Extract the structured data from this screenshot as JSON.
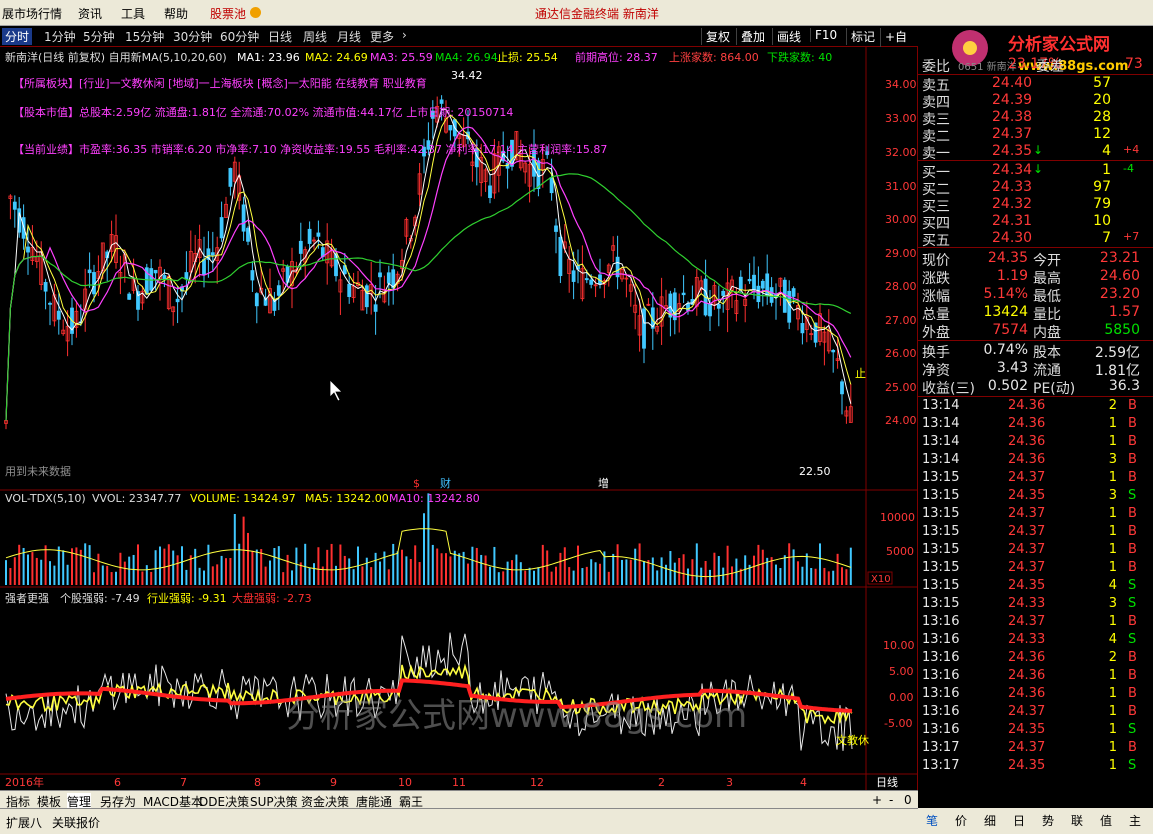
{
  "menubar": {
    "items": [
      "展市场行情",
      "资讯",
      "工具",
      "帮助",
      "股票池"
    ],
    "center": "通达信金融终端   新南洋",
    "logo_text": "分析家公式网",
    "logo_url": "www.88gs.com",
    "logo_sub": "0651 新南洋"
  },
  "timeframes": {
    "items": [
      "分时",
      "1分钟",
      "5分钟",
      "15分钟",
      "30分钟",
      "60分钟",
      "日线",
      "周线",
      "月线",
      "更多"
    ],
    "active": "分时",
    "right": [
      "复权",
      "叠加",
      "画线",
      "F10",
      "标记",
      "+自选"
    ]
  },
  "price_chart": {
    "title": "新南洋(日线 前复权) 自用新MA(5,10,20,60)",
    "ma_labels": [
      "MA1: 23.96",
      "MA2: 24.69",
      "MA3: 25.59",
      "MA4: 26.94",
      "止损: 25.54",
      "前期高位: 28.37",
      "上涨家数: 864.00",
      "下跌家数: 40"
    ],
    "info_lines": [
      "【所属板块】[行业]一文教休闲 [地域]一上海板块 [概念]一太阳能 在线教育 职业教育",
      "【股本市值】总股本:2.59亿 流通盘:1.81亿 全流通:70.02% 流通市值:44.17亿 上市日期: 20150714",
      "【当前业绩】市盈率:36.35 市销率:6.20 市净率:7.10 净资收益率:19.55 毛利率:42.37 净利率:17.14 主营利润率:15.87"
    ],
    "y_ticks": [
      "34.00",
      "33.00",
      "32.00",
      "31.00",
      "30.00",
      "29.00",
      "28.00",
      "27.00",
      "26.00",
      "25.00",
      "24.00"
    ],
    "high_label": "34.42",
    "low_label": "22.50",
    "note": "用到未来数据",
    "markers": [
      "$",
      "财",
      "增"
    ],
    "right_flag": "止"
  },
  "vol_chart": {
    "labels": [
      "VOL-TDX(5,10)",
      "VVOL: 23347.77",
      "VOLUME: 13424.97",
      "MA5: 13242.00",
      "MA10: 13242.80"
    ],
    "y_ticks": [
      "10000",
      "5000"
    ],
    "unit": "X10"
  },
  "strength_chart": {
    "labels": [
      "强者更强",
      "个股强弱: -7.49",
      "行业强弱: -9.31",
      "大盘强弱: -2.73"
    ],
    "y_ticks": [
      "10.00",
      "5.00",
      "0.00",
      "-5.00"
    ],
    "watermark": "分析家公式网www.88gs.com",
    "tail": "文教休"
  },
  "x_axis": {
    "labels": [
      "2016年",
      "6",
      "7",
      "8",
      "9",
      "10",
      "11",
      "12",
      "2",
      "3",
      "4"
    ],
    "period": "日线"
  },
  "bottom_tabs": {
    "items": [
      "指标",
      "模板",
      "管理",
      "另存为",
      "MACD基本",
      "DDE决策",
      "SUP决策",
      "资金决策",
      "唐能通",
      "霸王"
    ],
    "active": "管理",
    "controls": [
      "+",
      "-",
      "0"
    ]
  },
  "status_tabs": [
    "扩展八",
    "关联报价"
  ],
  "quote": {
    "weibi": {
      "label": "委比",
      "value": "23.17%",
      "label2": "委差",
      "value2": "73"
    },
    "asks": [
      {
        "label": "卖五",
        "price": "24.40",
        "vol": "57",
        "chg": ""
      },
      {
        "label": "卖四",
        "price": "24.39",
        "vol": "20",
        "chg": ""
      },
      {
        "label": "卖三",
        "price": "24.38",
        "vol": "28",
        "chg": ""
      },
      {
        "label": "卖二",
        "price": "24.37",
        "vol": "12",
        "chg": ""
      },
      {
        "label": "卖一",
        "price": "24.35",
        "vol": "4",
        "chg": "+4"
      }
    ],
    "bids": [
      {
        "label": "买一",
        "price": "24.34",
        "vol": "1",
        "chg": "-4"
      },
      {
        "label": "买二",
        "price": "24.33",
        "vol": "97",
        "chg": ""
      },
      {
        "label": "买三",
        "price": "24.32",
        "vol": "79",
        "chg": ""
      },
      {
        "label": "买四",
        "price": "24.31",
        "vol": "10",
        "chg": ""
      },
      {
        "label": "买五",
        "price": "24.30",
        "vol": "7",
        "chg": "+7"
      }
    ],
    "stats": [
      {
        "l1": "现价",
        "v1": "24.35",
        "l2": "今开",
        "v2": "23.21"
      },
      {
        "l1": "涨跌",
        "v1": "1.19",
        "l2": "最高",
        "v2": "24.60"
      },
      {
        "l1": "涨幅",
        "v1": "5.14%",
        "l2": "最低",
        "v2": "23.20"
      },
      {
        "l1": "总量",
        "v1": "13424",
        "l2": "量比",
        "v2": "1.57"
      },
      {
        "l1": "外盘",
        "v1": "7574",
        "l2": "内盘",
        "v2": "5850"
      }
    ],
    "stats2": [
      {
        "l1": "换手",
        "v1": "0.74%",
        "l2": "股本",
        "v2": "2.59亿"
      },
      {
        "l1": "净资",
        "v1": "3.43",
        "l2": "流通",
        "v2": "1.81亿"
      },
      {
        "l1": "收益(三)",
        "v1": "0.502",
        "l2": "PE(动)",
        "v2": "36.3"
      }
    ],
    "ticks": [
      [
        "13:14",
        "24.36",
        "2",
        "B"
      ],
      [
        "13:14",
        "24.36",
        "1",
        "B"
      ],
      [
        "13:14",
        "24.36",
        "1",
        "B"
      ],
      [
        "13:14",
        "24.36",
        "3",
        "B"
      ],
      [
        "13:15",
        "24.37",
        "1",
        "B"
      ],
      [
        "13:15",
        "24.35",
        "3",
        "S"
      ],
      [
        "13:15",
        "24.37",
        "1",
        "B"
      ],
      [
        "13:15",
        "24.37",
        "1",
        "B"
      ],
      [
        "13:15",
        "24.37",
        "1",
        "B"
      ],
      [
        "13:15",
        "24.37",
        "1",
        "B"
      ],
      [
        "13:15",
        "24.35",
        "4",
        "S"
      ],
      [
        "13:15",
        "24.33",
        "3",
        "S"
      ],
      [
        "13:16",
        "24.37",
        "1",
        "B"
      ],
      [
        "13:16",
        "24.33",
        "4",
        "S"
      ],
      [
        "13:16",
        "24.36",
        "2",
        "B"
      ],
      [
        "13:16",
        "24.36",
        "1",
        "B"
      ],
      [
        "13:16",
        "24.36",
        "1",
        "B"
      ],
      [
        "13:16",
        "24.37",
        "1",
        "B"
      ],
      [
        "13:16",
        "24.35",
        "1",
        "S"
      ],
      [
        "13:17",
        "24.37",
        "1",
        "B"
      ],
      [
        "13:17",
        "24.35",
        "1",
        "S"
      ]
    ]
  },
  "right_tabs": [
    "笔",
    "价",
    "细",
    "日",
    "势",
    "联",
    "值",
    "主"
  ]
}
